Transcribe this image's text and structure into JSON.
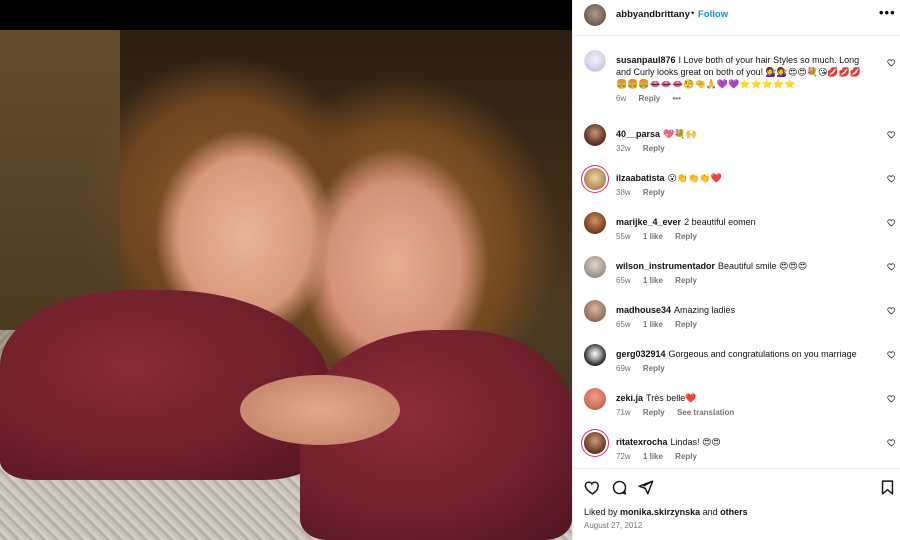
{
  "post": {
    "username": "abbyandbrittany",
    "separator": "•",
    "follow_label": "Follow",
    "more_label": "•••"
  },
  "comments": [
    {
      "username": "susanpaul876",
      "text": "I Love both of your hair Styles so much. Long and Curly looks great on both of you! 💇‍♀️💇‍♀️😍😍💐😘💋💋💋🍔🍔🍔👄👄👄🧐🤏🙏💜💜⭐⭐⭐⭐⭐",
      "time": "6w",
      "reply": "Reply",
      "extra": "•••",
      "likes": ""
    },
    {
      "username": "40__parsa",
      "text": "💖💐🙌",
      "time": "32w",
      "reply": "Reply",
      "likes": ""
    },
    {
      "username": "ilzaabatista",
      "text": "😮👏👏👏❤️",
      "time": "38w",
      "reply": "Reply",
      "likes": ""
    },
    {
      "username": "marijke_4_ever",
      "text": "2 beautiful eomen",
      "time": "55w",
      "likes": "1 like",
      "reply": "Reply"
    },
    {
      "username": "wilson_instrumentador",
      "text": "Beautiful smile 😍😍😍",
      "time": "65w",
      "likes": "1 like",
      "reply": "Reply"
    },
    {
      "username": "madhouse34",
      "text": "Amazing ladies",
      "time": "65w",
      "likes": "1 like",
      "reply": "Reply"
    },
    {
      "username": "gerg032914",
      "text": "Gorgeous and congratulations on you marriage",
      "time": "69w",
      "reply": "Reply",
      "likes": ""
    },
    {
      "username": "zeki.ja",
      "text": "Très belle❤️",
      "time": "71w",
      "reply": "Reply",
      "see_translation": "See translation",
      "likes": ""
    },
    {
      "username": "ritatexrocha",
      "text": "Lindas! 😍😍",
      "time": "72w",
      "likes": "1 like",
      "reply": "Reply"
    }
  ],
  "footer": {
    "liked_by_prefix": "Liked by",
    "liked_by_user": "monika.skirzynska",
    "liked_by_and": "and",
    "liked_by_others": "others",
    "date": "August 27, 2012"
  },
  "colors": {
    "accent": "#0095f6",
    "muted": "#737373",
    "border": "#efefef"
  },
  "icons": [
    "heart-icon",
    "comment-icon",
    "share-icon",
    "bookmark-icon",
    "more-icon"
  ]
}
